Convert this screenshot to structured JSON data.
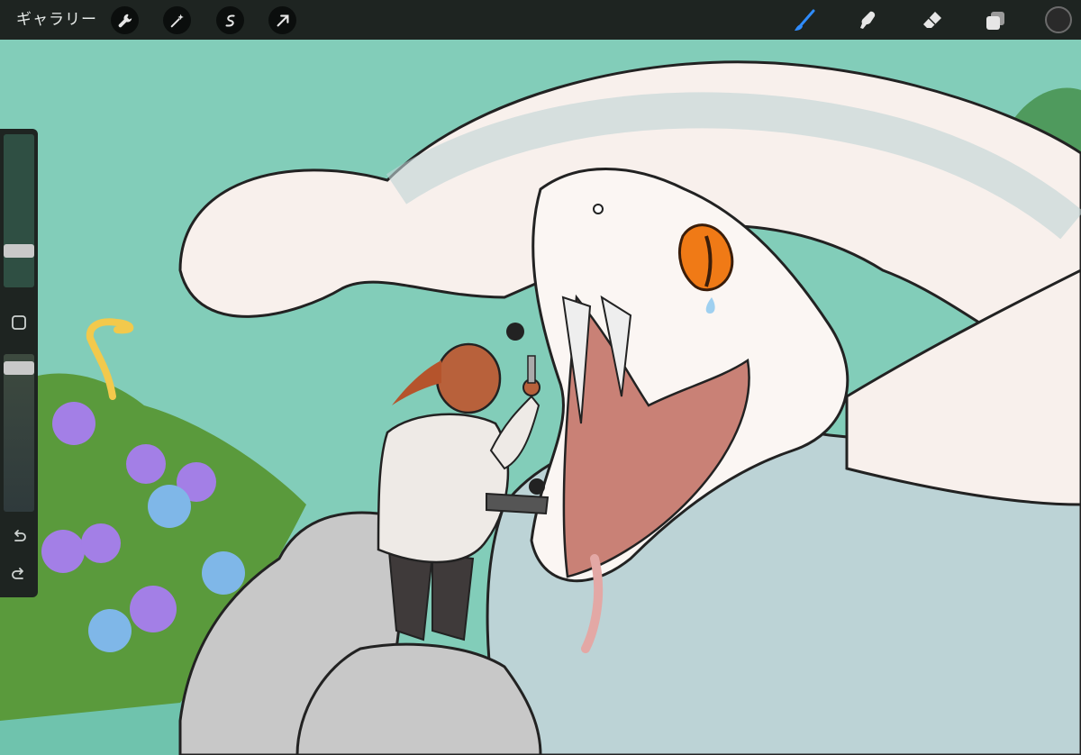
{
  "app": {
    "gallery_label": "ギャラリー"
  },
  "toolbar_left": [
    {
      "name": "wrench-icon",
      "label": "actions"
    },
    {
      "name": "magic-wand-icon",
      "label": "adjustments"
    },
    {
      "name": "selection-s-icon",
      "label": "selection"
    },
    {
      "name": "arrow-cursor-icon",
      "label": "transform"
    }
  ],
  "toolbar_right": [
    {
      "name": "brush-icon",
      "label": "paint",
      "active": true
    },
    {
      "name": "smudge-icon",
      "label": "smudge",
      "active": false
    },
    {
      "name": "eraser-icon",
      "label": "erase",
      "active": false
    },
    {
      "name": "layers-icon",
      "label": "layers",
      "active": false
    }
  ],
  "current_color": "#2a2a2a",
  "accent_color": "#2f8cff",
  "sidebar": {
    "brush_size_level": 0.74,
    "opacity_level": 0.0,
    "modify_button": "square-modify-icon",
    "undo_icon": "undo-icon",
    "redo_icon": "redo-icon"
  },
  "canvas_subject": "artwork"
}
